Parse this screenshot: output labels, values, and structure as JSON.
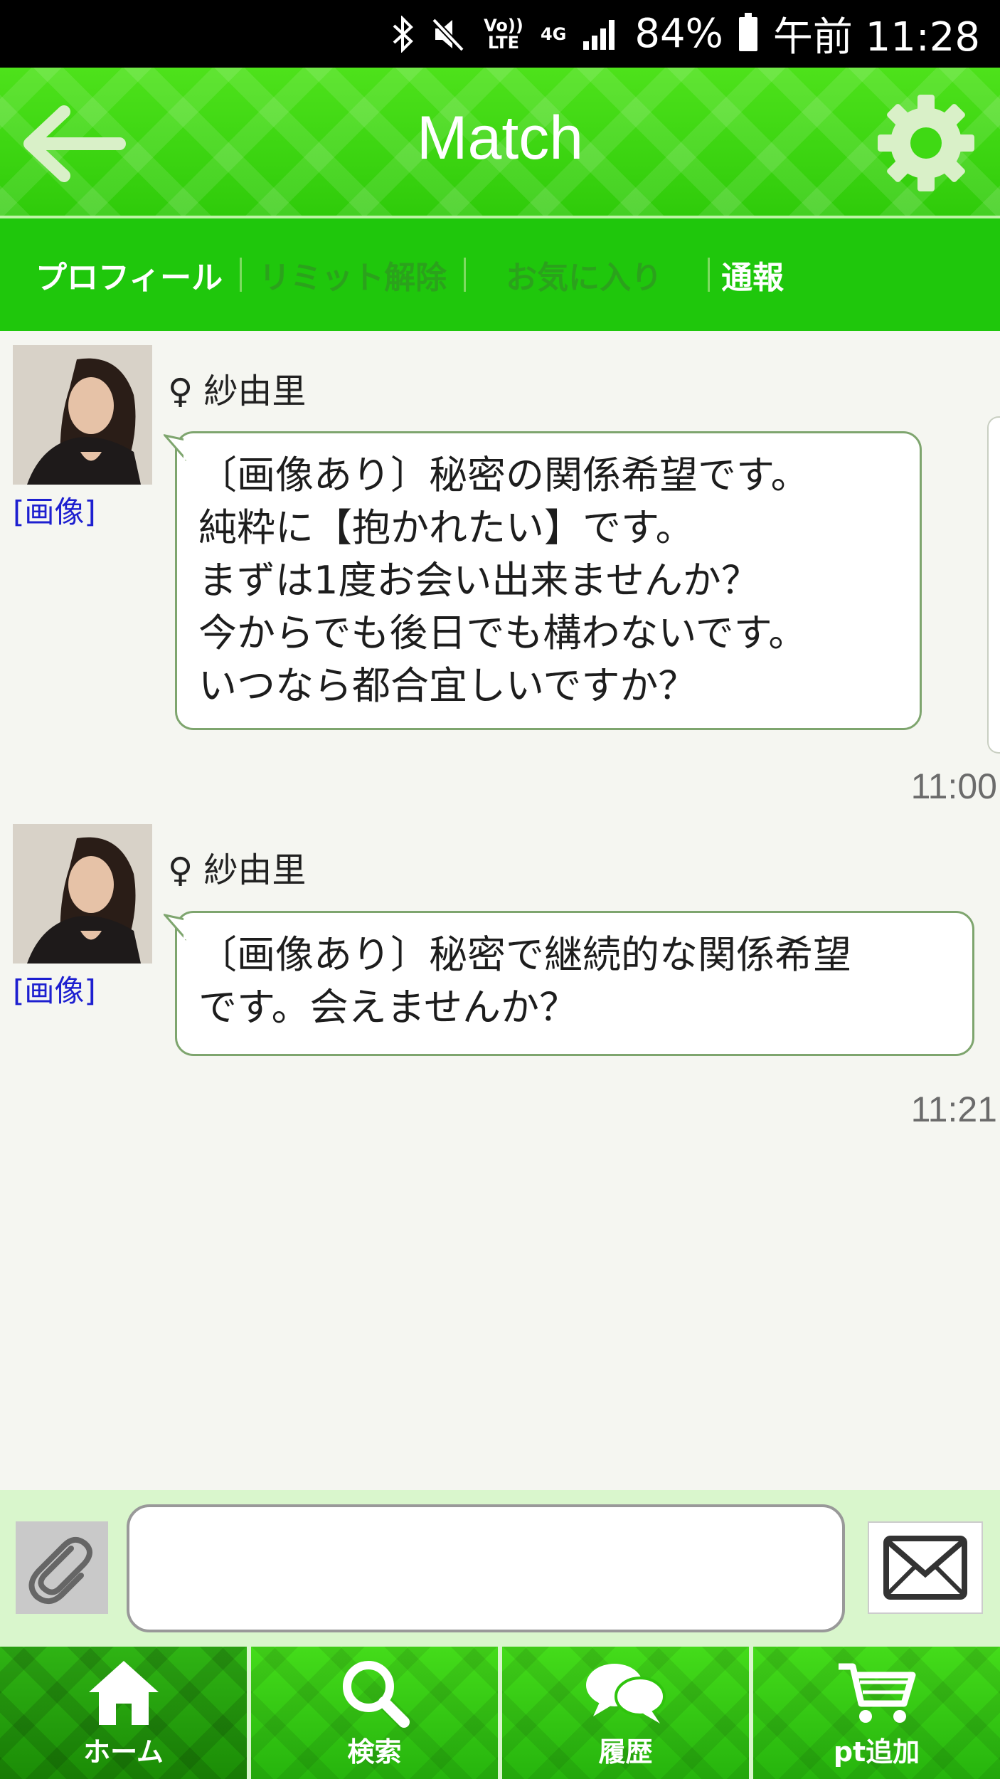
{
  "status_bar": {
    "volte": "Vo)) LTE",
    "network": "4G",
    "battery": "84%",
    "time": "午前 11:28"
  },
  "header": {
    "title": "Match",
    "back_icon": "arrow-left-icon",
    "settings_icon": "gear-icon"
  },
  "tabs": [
    {
      "label": "プロフィール",
      "active": true
    },
    {
      "label": "リミット解除",
      "active": false
    },
    {
      "label": "お気に入り",
      "active": false
    },
    {
      "label": "通報",
      "active": true
    }
  ],
  "messages": [
    {
      "sender": "♀ 紗由里",
      "image_link": "[画像]",
      "lines": [
        "〔画像あり〕秘密の関係希望です。",
        "純粋に【抱かれたい】です。",
        "まずは1度お会い出来ませんか？",
        "今からでも後日でも構わないです。",
        "いつなら都合宜しいですか？"
      ],
      "time": "11:00"
    },
    {
      "sender": "♀ 紗由里",
      "image_link": "[画像]",
      "lines": [
        "〔画像あり〕秘密で継続的な関係希望",
        "です。会えませんか？"
      ],
      "time": "11:21"
    }
  ],
  "composer": {
    "input_value": "",
    "attach_icon": "paperclip-icon",
    "send_icon": "envelope-icon"
  },
  "bottom_nav": [
    {
      "label": "ホーム",
      "icon": "home-icon",
      "active": true
    },
    {
      "label": "検索",
      "icon": "search-icon",
      "active": false
    },
    {
      "label": "履歴",
      "icon": "chat-bubbles-icon",
      "active": false
    },
    {
      "label": "pt追加",
      "icon": "cart-icon",
      "active": false
    }
  ],
  "colors": {
    "header_green": "#3fd914",
    "tab_bar_green": "#1fc70c",
    "link_blue": "#1d1fd0",
    "bubble_border": "#7ea56e"
  }
}
